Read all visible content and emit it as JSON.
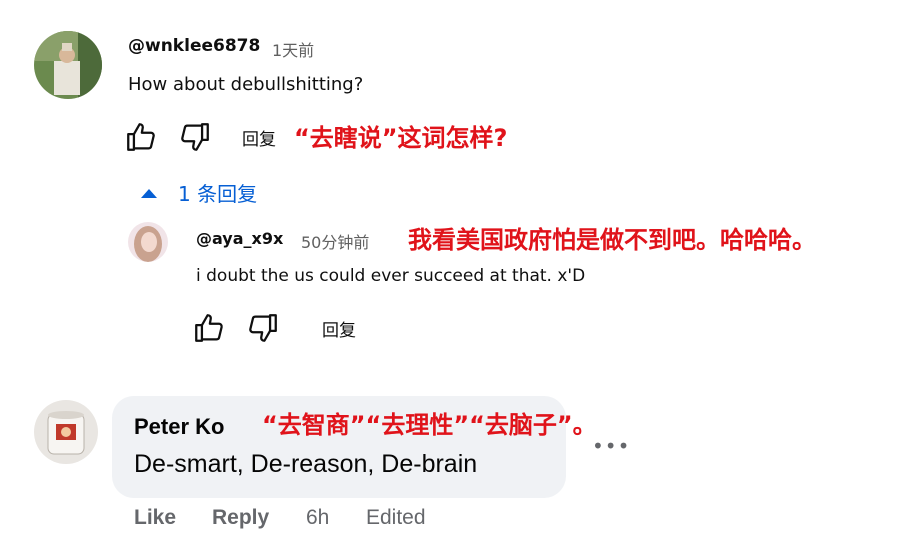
{
  "comment1": {
    "handle": "@wnklee6878",
    "time": "1天前",
    "text": "How about debullshitting?",
    "reply_label": "回复",
    "annotation": "“去瞎说”这词怎样?",
    "replies_toggle": "1 条回复"
  },
  "reply1": {
    "handle": "@aya_x9x",
    "time": "50分钟前",
    "annotation": "我看美国政府怕是做不到吧。哈哈哈。",
    "text": "i doubt the us could ever succeed at that.  x'D",
    "reply_label": "回复"
  },
  "comment2": {
    "name": "Peter Ko",
    "annotation": "“去智商”“去理性”“去脑子”。",
    "text": "De-smart, De-reason, De-brain",
    "like_label": "Like",
    "reply_label": "Reply",
    "time": "6h",
    "edited": "Edited",
    "more": "•••"
  },
  "colors": {
    "annotation": "#e0131a",
    "link_blue": "#065fd4",
    "bubble": "#f0f2f5"
  }
}
